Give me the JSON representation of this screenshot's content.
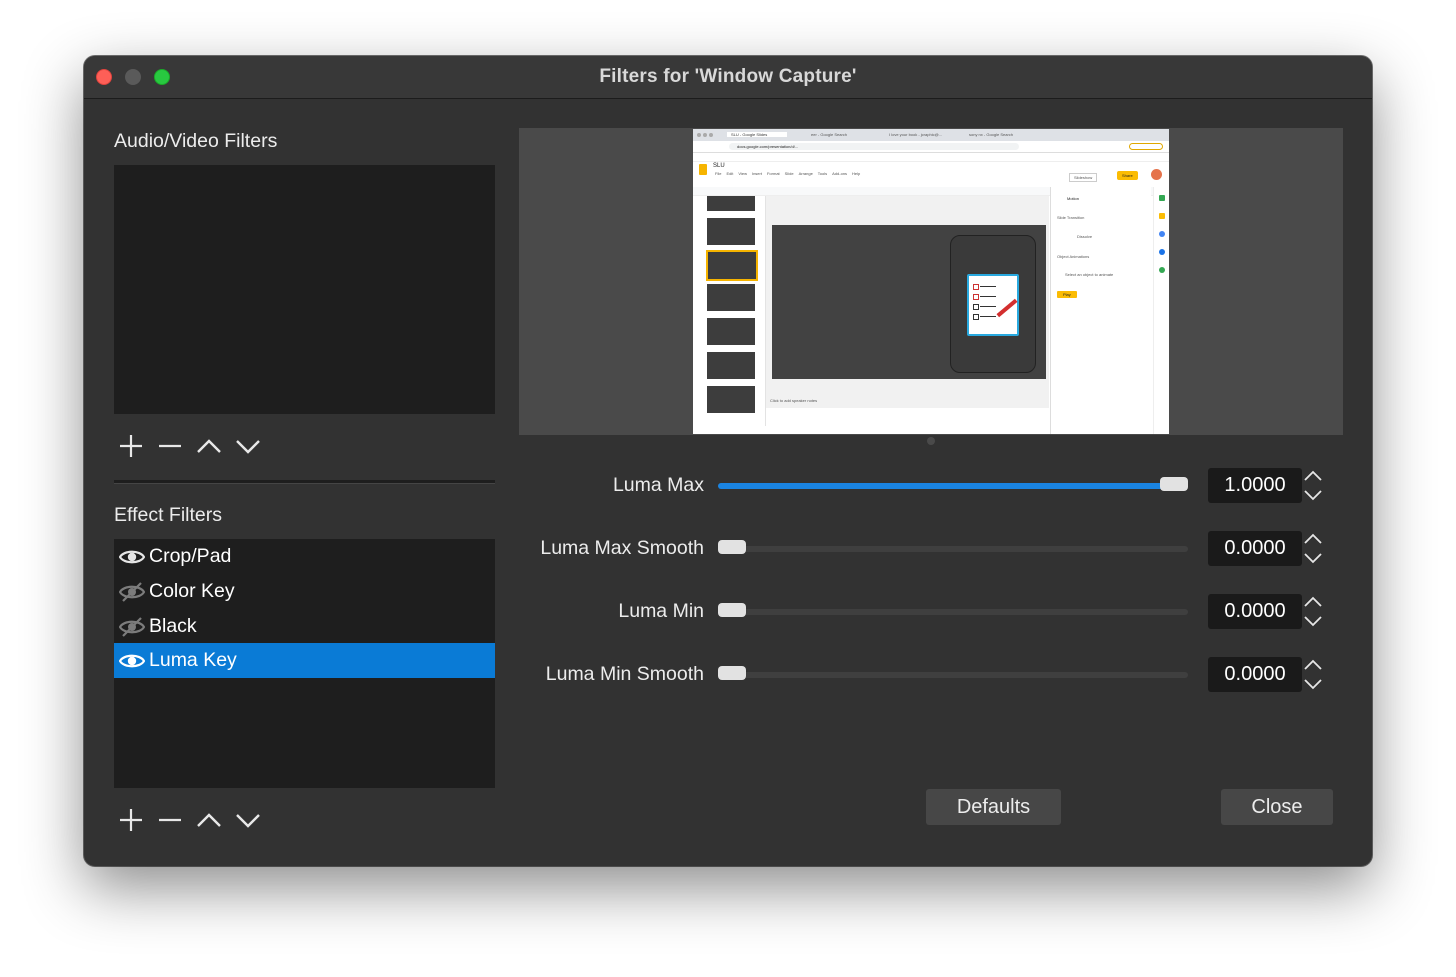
{
  "window": {
    "title": "Filters for 'Window Capture'"
  },
  "audio_video": {
    "label": "Audio/Video Filters"
  },
  "effect": {
    "label": "Effect Filters",
    "items": [
      {
        "label": "Crop/Pad",
        "visible": true
      },
      {
        "label": "Color Key",
        "visible": false
      },
      {
        "label": "Black",
        "visible": false
      },
      {
        "label": "Luma Key",
        "visible": true,
        "selected": true
      }
    ]
  },
  "toolbar_icons": [
    "add-icon",
    "remove-icon",
    "move-up-icon",
    "move-down-icon"
  ],
  "properties": [
    {
      "label": "Luma Max",
      "value": "1.0000",
      "fraction": 1.0
    },
    {
      "label": "Luma Max Smooth",
      "value": "0.0000",
      "fraction": 0.0
    },
    {
      "label": "Luma Min",
      "value": "0.0000",
      "fraction": 0.0
    },
    {
      "label": "Luma Min Smooth",
      "value": "0.0000",
      "fraction": 0.0
    }
  ],
  "buttons": {
    "defaults": "Defaults",
    "close": "Close"
  },
  "preview": {
    "doc_title": "SLU",
    "browser_tabs": [
      "SLU - Google Slides",
      "eer - Google Search",
      "I love your book - jcraphic@...",
      "sony nx - Google Search"
    ],
    "url": "docs.google.com/presentation/d/...",
    "menu_items": [
      "File",
      "Edit",
      "View",
      "Insert",
      "Format",
      "Slide",
      "Arrange",
      "Tools",
      "Add-ons",
      "Help"
    ],
    "slideshow_label": "Slideshow",
    "share_label": "Share",
    "panel_title": "Motion",
    "panel_rows": [
      "Slide Transition",
      "Dissolve",
      "Object Animations",
      "Select an object to animate"
    ],
    "play_label": "Play",
    "notes_placeholder": "Click to add speaker notes",
    "accent_color": "#fbbc04"
  },
  "colors": {
    "selection": "#0a7bd6",
    "slider_fill": "#1a84e2",
    "window_bg": "#323232"
  }
}
